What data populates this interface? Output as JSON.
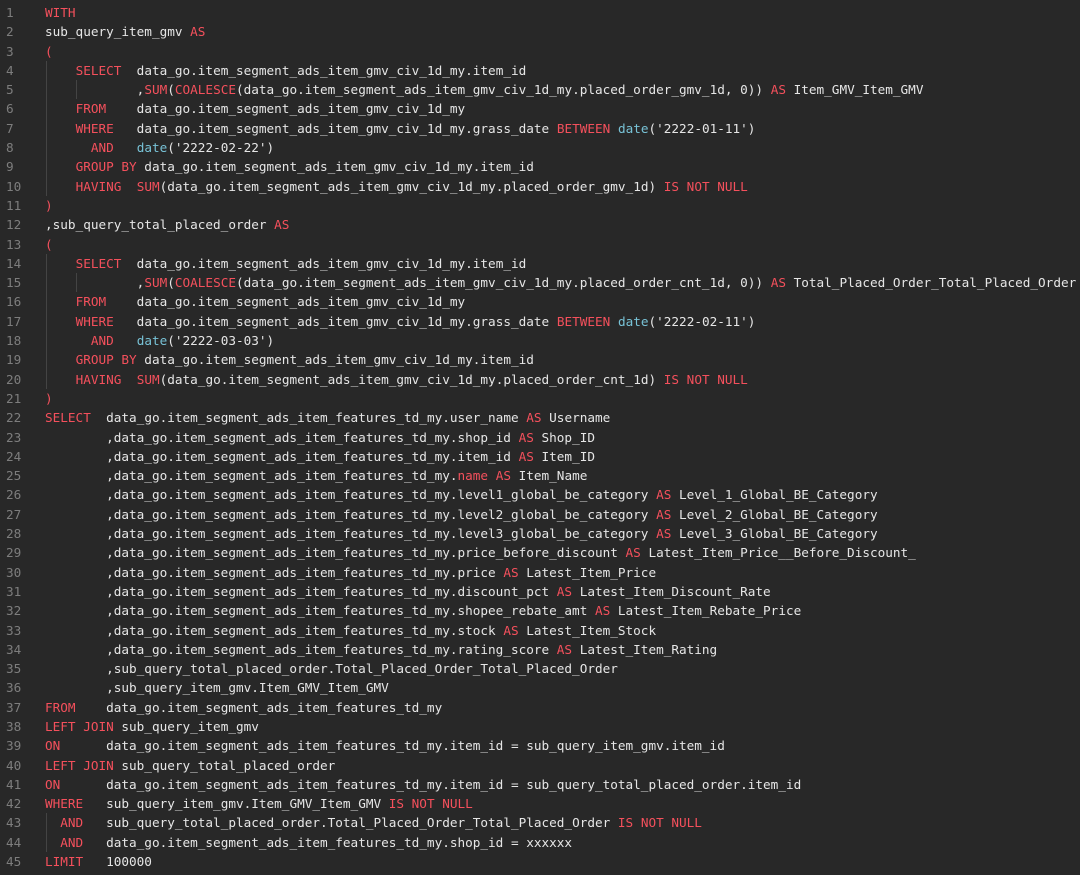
{
  "editor": {
    "language": "SQL",
    "colors": {
      "background": "#282828",
      "keyword": "#f4505c",
      "string": "#dcdcaa",
      "date_fn": "#78c2d6",
      "text": "#e6e6e6",
      "line_number": "#7d7d7d"
    },
    "lines": [
      {
        "n": "1",
        "tokens": [
          [
            "kw",
            "WITH"
          ]
        ]
      },
      {
        "n": "2",
        "tokens": [
          [
            "plain",
            "sub_query_item_gmv "
          ],
          [
            "kw",
            "AS"
          ]
        ]
      },
      {
        "n": "3",
        "tokens": [
          [
            "kw",
            "("
          ]
        ]
      },
      {
        "n": "4",
        "tokens": [
          [
            "plain",
            "    "
          ],
          [
            "kw",
            "SELECT"
          ],
          [
            "plain",
            "  data_go.item_segment_ads_item_gmv_civ_1d_my.item_id"
          ]
        ]
      },
      {
        "n": "5",
        "tokens": [
          [
            "plain",
            "            ,"
          ],
          [
            "kw",
            "SUM"
          ],
          [
            "plain",
            "("
          ],
          [
            "kw",
            "COALESCE"
          ],
          [
            "plain",
            "(data_go.item_segment_ads_item_gmv_civ_1d_my.placed_order_gmv_1d, 0)) "
          ],
          [
            "kw",
            "AS"
          ],
          [
            "plain",
            " Item_GMV_Item_GMV"
          ]
        ]
      },
      {
        "n": "6",
        "tokens": [
          [
            "plain",
            "    "
          ],
          [
            "kw",
            "FROM"
          ],
          [
            "plain",
            "    data_go.item_segment_ads_item_gmv_civ_1d_my"
          ]
        ]
      },
      {
        "n": "7",
        "tokens": [
          [
            "plain",
            "    "
          ],
          [
            "kw",
            "WHERE"
          ],
          [
            "plain",
            "   data_go.item_segment_ads_item_gmv_civ_1d_my.grass_date "
          ],
          [
            "kw",
            "BETWEEN"
          ],
          [
            "plain",
            " "
          ],
          [
            "date",
            "date"
          ],
          [
            "plain",
            "('2222-01-11')"
          ]
        ]
      },
      {
        "n": "8",
        "tokens": [
          [
            "plain",
            "      "
          ],
          [
            "kw",
            "AND"
          ],
          [
            "plain",
            "   "
          ],
          [
            "date",
            "date"
          ],
          [
            "plain",
            "('2222-02-22')"
          ]
        ]
      },
      {
        "n": "9",
        "tokens": [
          [
            "plain",
            "    "
          ],
          [
            "kw",
            "GROUP BY"
          ],
          [
            "plain",
            " data_go.item_segment_ads_item_gmv_civ_1d_my.item_id"
          ]
        ]
      },
      {
        "n": "10",
        "tokens": [
          [
            "plain",
            "    "
          ],
          [
            "kw",
            "HAVING"
          ],
          [
            "plain",
            "  "
          ],
          [
            "kw",
            "SUM"
          ],
          [
            "plain",
            "(data_go.item_segment_ads_item_gmv_civ_1d_my.placed_order_gmv_1d) "
          ],
          [
            "kw",
            "IS NOT NULL"
          ]
        ]
      },
      {
        "n": "11",
        "tokens": [
          [
            "kw",
            ")"
          ]
        ]
      },
      {
        "n": "12",
        "tokens": [
          [
            "plain",
            ",sub_query_total_placed_order "
          ],
          [
            "kw",
            "AS"
          ]
        ]
      },
      {
        "n": "13",
        "tokens": [
          [
            "kw",
            "("
          ]
        ]
      },
      {
        "n": "14",
        "tokens": [
          [
            "plain",
            "    "
          ],
          [
            "kw",
            "SELECT"
          ],
          [
            "plain",
            "  data_go.item_segment_ads_item_gmv_civ_1d_my.item_id"
          ]
        ]
      },
      {
        "n": "15",
        "tokens": [
          [
            "plain",
            "            ,"
          ],
          [
            "kw",
            "SUM"
          ],
          [
            "plain",
            "("
          ],
          [
            "kw",
            "COALESCE"
          ],
          [
            "plain",
            "(data_go.item_segment_ads_item_gmv_civ_1d_my.placed_order_cnt_1d, 0)) "
          ],
          [
            "kw",
            "AS"
          ],
          [
            "plain",
            " Total_Placed_Order_Total_Placed_Order"
          ]
        ]
      },
      {
        "n": "16",
        "tokens": [
          [
            "plain",
            "    "
          ],
          [
            "kw",
            "FROM"
          ],
          [
            "plain",
            "    data_go.item_segment_ads_item_gmv_civ_1d_my"
          ]
        ]
      },
      {
        "n": "17",
        "tokens": [
          [
            "plain",
            "    "
          ],
          [
            "kw",
            "WHERE"
          ],
          [
            "plain",
            "   data_go.item_segment_ads_item_gmv_civ_1d_my.grass_date "
          ],
          [
            "kw",
            "BETWEEN"
          ],
          [
            "plain",
            " "
          ],
          [
            "date",
            "date"
          ],
          [
            "plain",
            "('2222-02-11')"
          ]
        ]
      },
      {
        "n": "18",
        "tokens": [
          [
            "plain",
            "      "
          ],
          [
            "kw",
            "AND"
          ],
          [
            "plain",
            "   "
          ],
          [
            "date",
            "date"
          ],
          [
            "plain",
            "('2222-03-03')"
          ]
        ]
      },
      {
        "n": "19",
        "tokens": [
          [
            "plain",
            "    "
          ],
          [
            "kw",
            "GROUP BY"
          ],
          [
            "plain",
            " data_go.item_segment_ads_item_gmv_civ_1d_my.item_id"
          ]
        ]
      },
      {
        "n": "20",
        "tokens": [
          [
            "plain",
            "    "
          ],
          [
            "kw",
            "HAVING"
          ],
          [
            "plain",
            "  "
          ],
          [
            "kw",
            "SUM"
          ],
          [
            "plain",
            "(data_go.item_segment_ads_item_gmv_civ_1d_my.placed_order_cnt_1d) "
          ],
          [
            "kw",
            "IS NOT NULL"
          ]
        ]
      },
      {
        "n": "21",
        "tokens": [
          [
            "kw",
            ")"
          ]
        ]
      },
      {
        "n": "22",
        "tokens": [
          [
            "kw",
            "SELECT"
          ],
          [
            "plain",
            "  data_go.item_segment_ads_item_features_td_my.user_name "
          ],
          [
            "kw",
            "AS"
          ],
          [
            "plain",
            " Username"
          ]
        ]
      },
      {
        "n": "23",
        "tokens": [
          [
            "plain",
            "        ,data_go.item_segment_ads_item_features_td_my.shop_id "
          ],
          [
            "kw",
            "AS"
          ],
          [
            "plain",
            " Shop_ID"
          ]
        ]
      },
      {
        "n": "24",
        "tokens": [
          [
            "plain",
            "        ,data_go.item_segment_ads_item_features_td_my.item_id "
          ],
          [
            "kw",
            "AS"
          ],
          [
            "plain",
            " Item_ID"
          ]
        ]
      },
      {
        "n": "25",
        "tokens": [
          [
            "plain",
            "        ,data_go.item_segment_ads_item_features_td_my."
          ],
          [
            "kw",
            "name"
          ],
          [
            "plain",
            " "
          ],
          [
            "kw",
            "AS"
          ],
          [
            "plain",
            " Item_Name"
          ]
        ]
      },
      {
        "n": "26",
        "tokens": [
          [
            "plain",
            "        ,data_go.item_segment_ads_item_features_td_my.level1_global_be_category "
          ],
          [
            "kw",
            "AS"
          ],
          [
            "plain",
            " Level_1_Global_BE_Category"
          ]
        ]
      },
      {
        "n": "27",
        "tokens": [
          [
            "plain",
            "        ,data_go.item_segment_ads_item_features_td_my.level2_global_be_category "
          ],
          [
            "kw",
            "AS"
          ],
          [
            "plain",
            " Level_2_Global_BE_Category"
          ]
        ]
      },
      {
        "n": "28",
        "tokens": [
          [
            "plain",
            "        ,data_go.item_segment_ads_item_features_td_my.level3_global_be_category "
          ],
          [
            "kw",
            "AS"
          ],
          [
            "plain",
            " Level_3_Global_BE_Category"
          ]
        ]
      },
      {
        "n": "29",
        "tokens": [
          [
            "plain",
            "        ,data_go.item_segment_ads_item_features_td_my.price_before_discount "
          ],
          [
            "kw",
            "AS"
          ],
          [
            "plain",
            " Latest_Item_Price__Before_Discount_"
          ]
        ]
      },
      {
        "n": "30",
        "tokens": [
          [
            "plain",
            "        ,data_go.item_segment_ads_item_features_td_my.price "
          ],
          [
            "kw",
            "AS"
          ],
          [
            "plain",
            " Latest_Item_Price"
          ]
        ]
      },
      {
        "n": "31",
        "tokens": [
          [
            "plain",
            "        ,data_go.item_segment_ads_item_features_td_my.discount_pct "
          ],
          [
            "kw",
            "AS"
          ],
          [
            "plain",
            " Latest_Item_Discount_Rate"
          ]
        ]
      },
      {
        "n": "32",
        "tokens": [
          [
            "plain",
            "        ,data_go.item_segment_ads_item_features_td_my.shopee_rebate_amt "
          ],
          [
            "kw",
            "AS"
          ],
          [
            "plain",
            " Latest_Item_Rebate_Price"
          ]
        ]
      },
      {
        "n": "33",
        "tokens": [
          [
            "plain",
            "        ,data_go.item_segment_ads_item_features_td_my.stock "
          ],
          [
            "kw",
            "AS"
          ],
          [
            "plain",
            " Latest_Item_Stock"
          ]
        ]
      },
      {
        "n": "34",
        "tokens": [
          [
            "plain",
            "        ,data_go.item_segment_ads_item_features_td_my.rating_score "
          ],
          [
            "kw",
            "AS"
          ],
          [
            "plain",
            " Latest_Item_Rating"
          ]
        ]
      },
      {
        "n": "35",
        "tokens": [
          [
            "plain",
            "        ,sub_query_total_placed_order.Total_Placed_Order_Total_Placed_Order"
          ]
        ]
      },
      {
        "n": "36",
        "tokens": [
          [
            "plain",
            "        ,sub_query_item_gmv.Item_GMV_Item_GMV"
          ]
        ]
      },
      {
        "n": "37",
        "tokens": [
          [
            "kw",
            "FROM"
          ],
          [
            "plain",
            "    data_go.item_segment_ads_item_features_td_my"
          ]
        ]
      },
      {
        "n": "38",
        "tokens": [
          [
            "kw",
            "LEFT JOIN"
          ],
          [
            "plain",
            " sub_query_item_gmv"
          ]
        ]
      },
      {
        "n": "39",
        "tokens": [
          [
            "kw",
            "ON"
          ],
          [
            "plain",
            "      data_go.item_segment_ads_item_features_td_my.item_id = sub_query_item_gmv.item_id"
          ]
        ]
      },
      {
        "n": "40",
        "tokens": [
          [
            "kw",
            "LEFT JOIN"
          ],
          [
            "plain",
            " sub_query_total_placed_order"
          ]
        ]
      },
      {
        "n": "41",
        "tokens": [
          [
            "kw",
            "ON"
          ],
          [
            "plain",
            "      data_go.item_segment_ads_item_features_td_my.item_id = sub_query_total_placed_order.item_id"
          ]
        ]
      },
      {
        "n": "42",
        "tokens": [
          [
            "kw",
            "WHERE"
          ],
          [
            "plain",
            "   sub_query_item_gmv.Item_GMV_Item_GMV "
          ],
          [
            "kw",
            "IS NOT NULL"
          ]
        ]
      },
      {
        "n": "43",
        "tokens": [
          [
            "plain",
            "  "
          ],
          [
            "kw",
            "AND"
          ],
          [
            "plain",
            "   sub_query_total_placed_order.Total_Placed_Order_Total_Placed_Order "
          ],
          [
            "kw",
            "IS NOT NULL"
          ]
        ]
      },
      {
        "n": "44",
        "tokens": [
          [
            "plain",
            "  "
          ],
          [
            "kw",
            "AND"
          ],
          [
            "plain",
            "   data_go.item_segment_ads_item_features_td_my.shop_id = xxxxxx"
          ]
        ]
      },
      {
        "n": "45",
        "tokens": [
          [
            "kw",
            "LIMIT"
          ],
          [
            "plain",
            "   100000"
          ]
        ]
      }
    ]
  }
}
